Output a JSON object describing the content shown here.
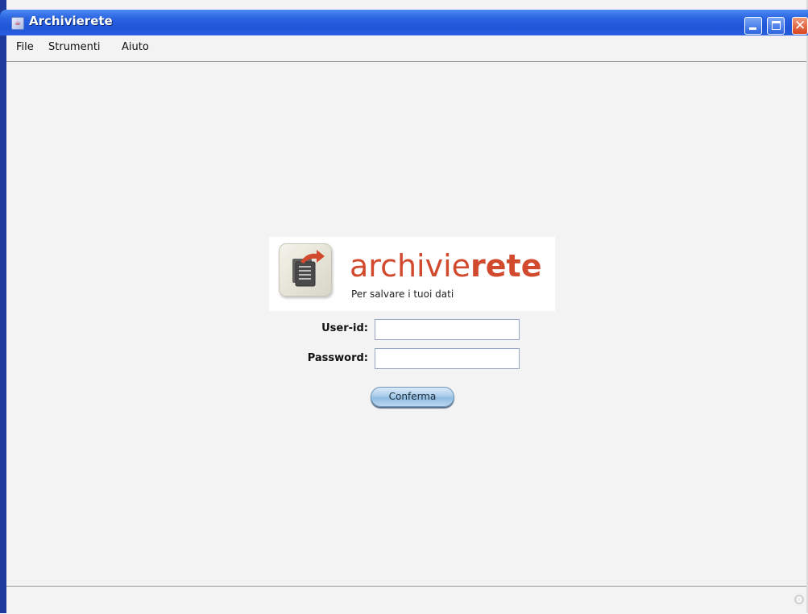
{
  "window": {
    "title": "Archivierete",
    "icon": "java-cup-icon",
    "controls": {
      "minimize": "minimize-icon",
      "maximize": "maximize-icon",
      "close": "close-icon",
      "close_glyph": "✕"
    }
  },
  "menubar": {
    "items": [
      "File",
      "Strumenti",
      "Aiuto"
    ]
  },
  "logo": {
    "word_part1": "archivie",
    "word_part2": "rete",
    "tagline": "Per salvare i tuoi dati",
    "brand_color": "#d24a2e"
  },
  "login": {
    "userid_label": "User-id:",
    "userid_value": "",
    "password_label": "Password:",
    "password_value": "",
    "confirm_label": "Conferma"
  },
  "colors": {
    "titlebar": "#2a63e0",
    "window_bg": "#f3f3f4",
    "button_blue": "#a9cde9"
  }
}
